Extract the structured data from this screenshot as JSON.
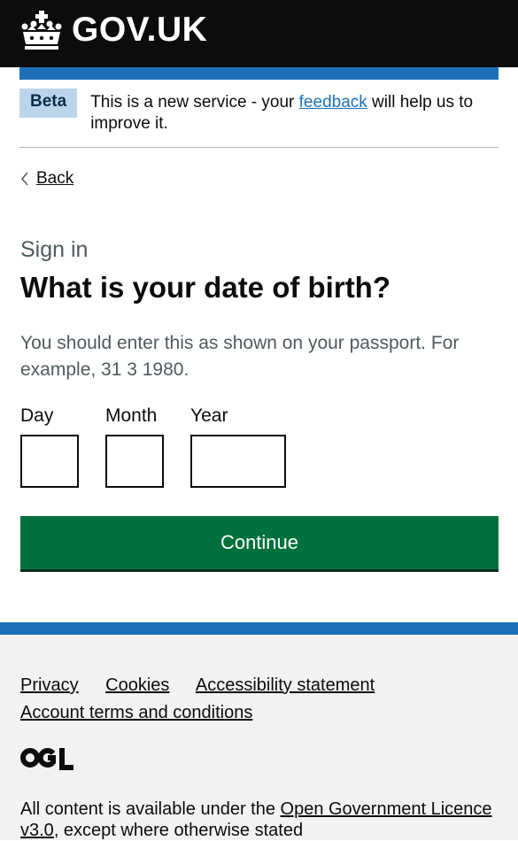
{
  "header": {
    "logo_text": "GOV.UK",
    "logo_icon": "crown-icon",
    "stripe_color": "#1d70b8"
  },
  "phase_banner": {
    "tag": "Beta",
    "text_before": "This is a new service - your ",
    "link": "feedback",
    "text_after": " will help us to improve it."
  },
  "back_link": "Back",
  "caption": "Sign in",
  "heading": "What is your date of birth?",
  "hint": "You should enter this as shown on your passport. For example, 31 3 1980.",
  "date_fields": {
    "day": {
      "label": "Day",
      "value": ""
    },
    "month": {
      "label": "Month",
      "value": ""
    },
    "year": {
      "label": "Year",
      "value": ""
    }
  },
  "continue_button": "Continue",
  "footer": {
    "links": [
      "Privacy",
      "Cookies",
      "Accessibility statement",
      "Account terms and conditions"
    ],
    "ogl_icon": "ogl-logo",
    "licence_before": "All content is available under the ",
    "licence_link": "Open Government Licence v3.0",
    "licence_after": ", except where otherwise stated"
  },
  "colors": {
    "header_bg": "#0b0c0c",
    "link": "#1d70b8",
    "button": "#00703c",
    "footer_bg": "#f3f2f1",
    "tag_bg": "#bbd4ea"
  }
}
